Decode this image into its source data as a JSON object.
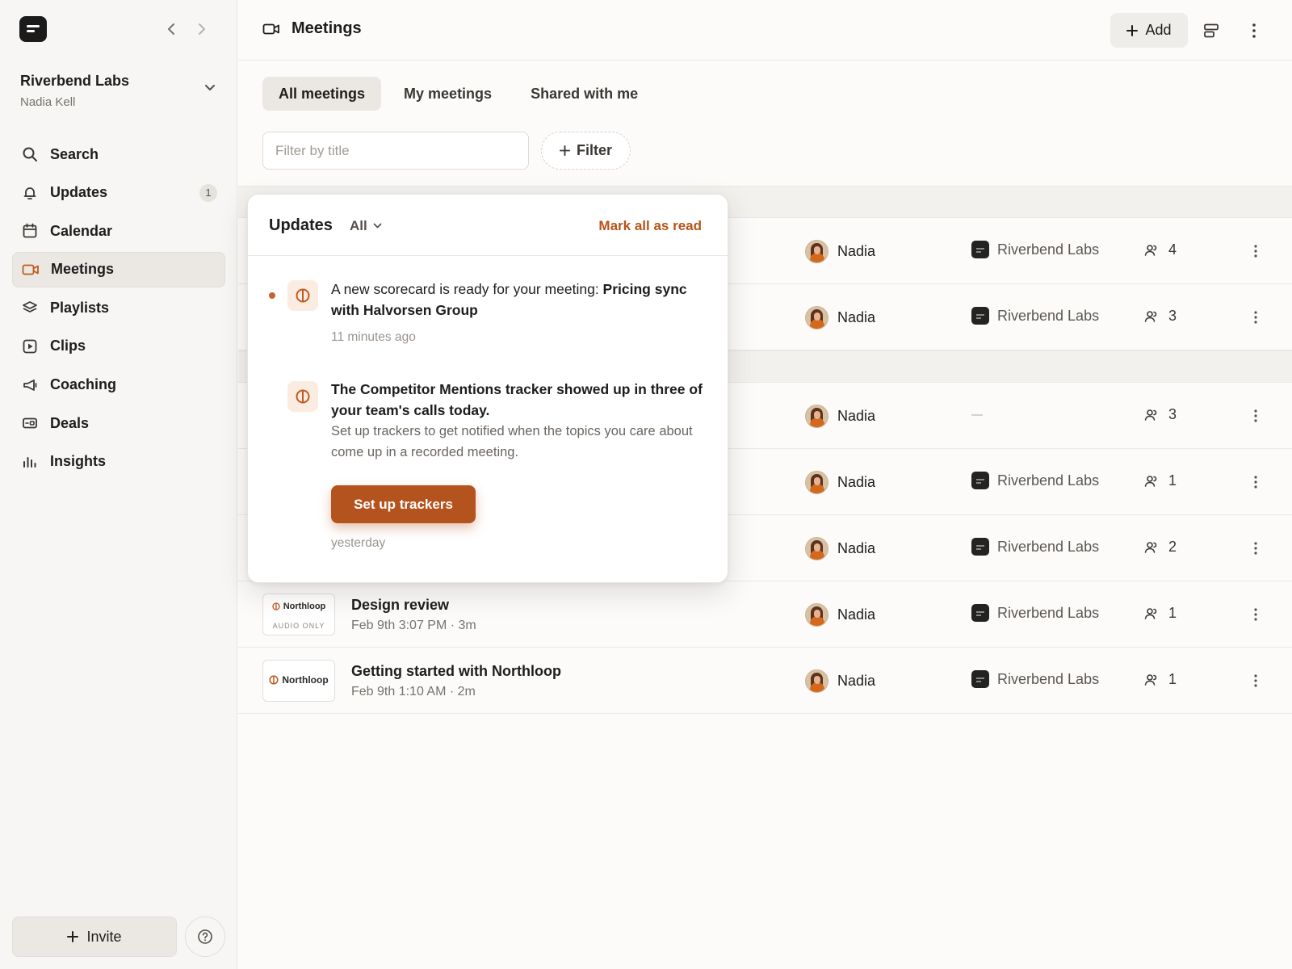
{
  "sidebar": {
    "workspace_name": "Riverbend Labs",
    "workspace_user": "Nadia Kell",
    "items": [
      {
        "label": "Search",
        "icon": "search-icon"
      },
      {
        "label": "Updates",
        "icon": "bell-icon",
        "badge": "1"
      },
      {
        "label": "Calendar",
        "icon": "calendar-icon"
      },
      {
        "label": "Meetings",
        "icon": "video-icon",
        "active": true
      },
      {
        "label": "Playlists",
        "icon": "layers-icon"
      },
      {
        "label": "Clips",
        "icon": "play-square-icon"
      },
      {
        "label": "Coaching",
        "icon": "megaphone-icon"
      },
      {
        "label": "Deals",
        "icon": "wallet-icon"
      },
      {
        "label": "Insights",
        "icon": "bar-chart-icon"
      }
    ],
    "invite_label": "Invite"
  },
  "header": {
    "title": "Meetings",
    "add_label": "Add"
  },
  "tabs": [
    {
      "label": "All meetings",
      "active": true
    },
    {
      "label": "My meetings"
    },
    {
      "label": "Shared with me"
    }
  ],
  "filter": {
    "placeholder": "Filter by title",
    "button_label": "Filter"
  },
  "meetings": [
    {
      "owner": "Nadia",
      "org": "Riverbend Labs",
      "participants": "4"
    },
    {
      "owner": "Nadia",
      "org": "Riverbend Labs",
      "participants": "3"
    },
    {
      "owner": "Nadia",
      "org": "",
      "participants": "3"
    },
    {
      "owner": "Nadia",
      "org": "Riverbend Labs",
      "participants": "1"
    },
    {
      "owner": "Nadia",
      "org": "Riverbend Labs",
      "participants": "2"
    },
    {
      "title": "Design review",
      "meta": "Feb 9th 3:07 PM · 3m",
      "thumb_brand": "Northloop",
      "thumb_sub": "AUDIO ONLY",
      "owner": "Nadia",
      "org": "Riverbend Labs",
      "participants": "1"
    },
    {
      "title": "Getting started with Northloop",
      "meta": "Feb 9th 1:10 AM · 2m",
      "thumb_brand": "Northloop",
      "owner": "Nadia",
      "org": "Riverbend Labs",
      "participants": "1"
    }
  ],
  "updates_popover": {
    "title": "Updates",
    "filter_label": "All",
    "mark_all_label": "Mark all as read",
    "notifications": [
      {
        "text_prefix": "A new scorecard is ready for your meeting: ",
        "text_bold": "Pricing sync with Halvorsen Group",
        "time": "11 minutes ago",
        "unread": true
      },
      {
        "title": "The Competitor Mentions tracker showed up in three of your team's calls today.",
        "body": "Set up trackers to get notified when the topics you care about come up in a recorded meeting.",
        "cta_label": "Set up trackers",
        "time": "yesterday",
        "unread": false
      }
    ]
  },
  "colors": {
    "accent": "#b4531e",
    "accent_text": "#b6541a",
    "unread_dot": "#c8642b",
    "sidebar_bg": "#f7f6f4"
  }
}
